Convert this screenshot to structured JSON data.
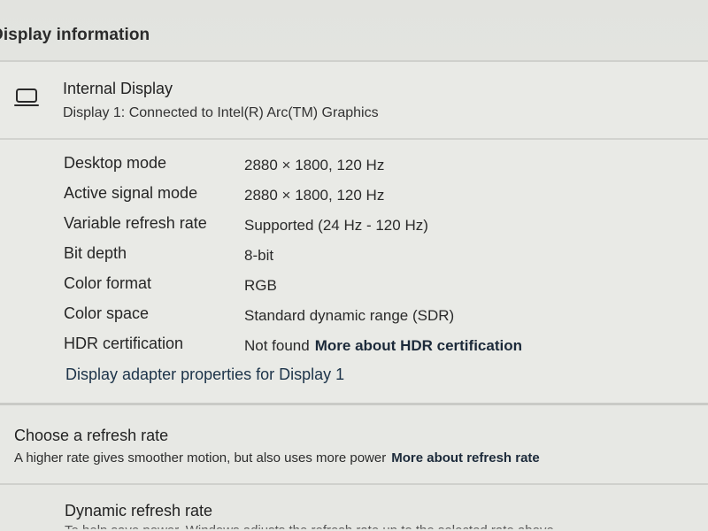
{
  "page": {
    "title": "Display information"
  },
  "display": {
    "icon": "laptop-icon",
    "name": "Internal Display",
    "subtitle": "Display 1: Connected to Intel(R) Arc(TM) Graphics",
    "rows": [
      {
        "label": "Desktop mode",
        "value": "2880 × 1800, 120 Hz"
      },
      {
        "label": "Active signal mode",
        "value": "2880 × 1800, 120 Hz"
      },
      {
        "label": "Variable refresh rate",
        "value": "Supported (24 Hz - 120 Hz)"
      },
      {
        "label": "Bit depth",
        "value": "8-bit"
      },
      {
        "label": "Color format",
        "value": "RGB"
      },
      {
        "label": "Color space",
        "value": "Standard dynamic range (SDR)"
      },
      {
        "label": "HDR certification",
        "value": "Not found",
        "link": "More about HDR certification"
      }
    ],
    "adapter_link": "Display adapter properties for Display 1"
  },
  "refresh": {
    "title": "Choose a refresh rate",
    "subtitle": "A higher rate gives smoother motion, but also uses more power",
    "link": "More about refresh rate"
  },
  "dynamic": {
    "title": "Dynamic refresh rate",
    "subtitle": "To help save power, Windows adjusts the refresh rate up to the selected rate above"
  }
}
